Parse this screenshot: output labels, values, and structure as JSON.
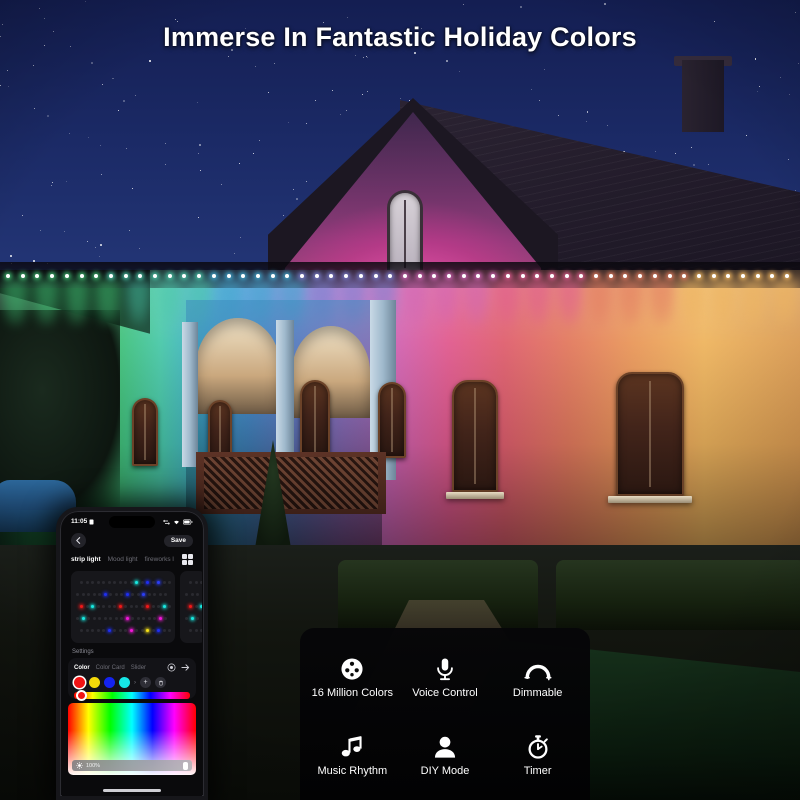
{
  "headline": "Immerse In Fantastic Holiday Colors",
  "scene": {
    "name": "night-house-rgb-lighting",
    "sky_color": "#1b2a66",
    "facade_colors": [
      "#3fbf72",
      "#49c8a8",
      "#3fa8cf",
      "#7a7fd0",
      "#d064b4",
      "#e05a8e",
      "#e2795e",
      "#eeb45e"
    ],
    "gable_wash": "#e05ab4"
  },
  "phone": {
    "status": {
      "time": "11:05",
      "battery_icon": "battery-icon",
      "wifi_icon": "wifi-icon",
      "signal_icon": "signal-icon",
      "alarm_icon": "alarm-icon"
    },
    "nav": {
      "back_icon": "back-arrow-icon",
      "save_label": "Save"
    },
    "tabs": [
      {
        "label": "strip light",
        "active": true
      },
      {
        "label": "Mood light",
        "active": false
      },
      {
        "label": "fireworks l",
        "active": false
      }
    ],
    "grid_icon": "grid-view-icon",
    "strip_preview": {
      "rows": [
        {
          "count": 17,
          "lit": [
            {
              "i": 10,
              "c": "#18e8e0"
            },
            {
              "i": 12,
              "c": "#1f2ff0"
            },
            {
              "i": 14,
              "c": "#2a3df5"
            }
          ]
        },
        {
          "count": 17,
          "lit": [
            {
              "i": 5,
              "c": "#1f2ff0"
            },
            {
              "i": 9,
              "c": "#1f2ff0"
            },
            {
              "i": 12,
              "c": "#2a3df5"
            }
          ]
        },
        {
          "count": 17,
          "lit": [
            {
              "i": 0,
              "c": "#f01818"
            },
            {
              "i": 2,
              "c": "#18e8e0"
            },
            {
              "i": 7,
              "c": "#f01818"
            },
            {
              "i": 12,
              "c": "#f01818"
            },
            {
              "i": 15,
              "c": "#18e8e0"
            }
          ]
        },
        {
          "count": 17,
          "lit": [
            {
              "i": 1,
              "c": "#18e8e0"
            },
            {
              "i": 9,
              "c": "#f018d8"
            },
            {
              "i": 15,
              "c": "#f018d8"
            }
          ]
        },
        {
          "count": 17,
          "lit": [
            {
              "i": 5,
              "c": "#1f2ff0"
            },
            {
              "i": 9,
              "c": "#f018d8"
            },
            {
              "i": 12,
              "c": "#f5e018"
            },
            {
              "i": 14,
              "c": "#1f2ff0"
            }
          ]
        }
      ]
    },
    "settings_label": "Settings",
    "color_panel": {
      "tabs": [
        {
          "label": "Color",
          "active": true
        },
        {
          "label": "Color Card",
          "active": false
        },
        {
          "label": "Slider",
          "active": false
        }
      ],
      "icons": [
        "record-circle-icon",
        "arrow-right-icon"
      ],
      "swatches": [
        "#f21414",
        "#f5d90a",
        "#1423f0",
        "#16e6e6"
      ],
      "selected_swatch": "#f21414",
      "add_label": "+",
      "delete_icon": "trash-icon",
      "brightness_value": "100%",
      "brightness_icon": "brightness-icon"
    }
  },
  "features": [
    {
      "label": "16 Million Colors",
      "icon": "color-palette-icon"
    },
    {
      "label": "Voice Control",
      "icon": "microphone-icon"
    },
    {
      "label": "Dimmable",
      "icon": "dimmer-arc-icon"
    },
    {
      "label": "Music Rhythm",
      "icon": "music-notes-icon"
    },
    {
      "label": "DIY Mode",
      "icon": "person-icon"
    },
    {
      "label": "Timer",
      "icon": "stopwatch-icon"
    }
  ]
}
